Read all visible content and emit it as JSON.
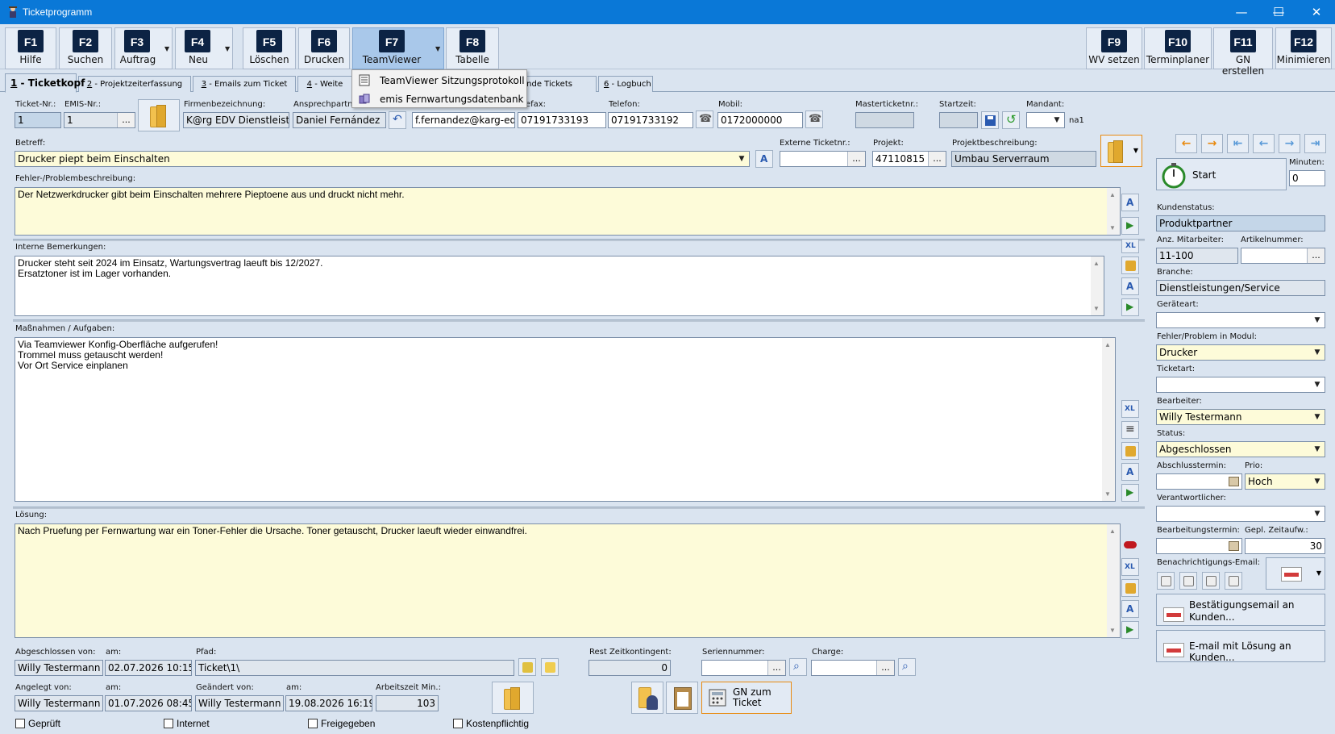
{
  "window": {
    "title": "Ticketprogramm",
    "minimize": "—",
    "maximize": "☐",
    "close": "✕"
  },
  "toolbar": {
    "buttons": [
      {
        "key": "F1",
        "label": "Hilfe"
      },
      {
        "key": "F2",
        "label": "Suchen"
      },
      {
        "key": "F3",
        "label": "Auftrag"
      },
      {
        "key": "F4",
        "label": "Neu"
      },
      {
        "key": "F5",
        "label": "Löschen"
      },
      {
        "key": "F6",
        "label": "Drucken"
      },
      {
        "key": "F7",
        "label": "TeamViewer"
      },
      {
        "key": "F8",
        "label": "Tabelle"
      },
      {
        "key": "F9",
        "label": "WV setzen"
      },
      {
        "key": "F10",
        "label": "Terminplaner"
      },
      {
        "key": "F11",
        "label": "GN erstellen"
      },
      {
        "key": "F12",
        "label": "Minimieren"
      }
    ]
  },
  "dropdown_menu": {
    "items": [
      "TeamViewer Sitzungsprotokoll",
      "emis Fernwartungsdatenbank"
    ]
  },
  "tabs": [
    {
      "num": "1",
      "label": " - Ticketkopf"
    },
    {
      "num": "2",
      "label": " - Projektzeiterfassung"
    },
    {
      "num": "3",
      "label": " - Emails zum Ticket"
    },
    {
      "num": "4",
      "label": " - Weite"
    },
    {
      "num": "",
      "label": "ende Tickets"
    },
    {
      "num": "6",
      "label": " - Logbuch"
    }
  ],
  "header_fields": {
    "ticket_nr": {
      "label": "Ticket-Nr.:",
      "value": "1"
    },
    "emis_nr": {
      "label": "EMIS-Nr.:",
      "value": "1"
    },
    "firma": {
      "label": "Firmenbezeichnung:",
      "value": "K@rg EDV Dienstleistungen"
    },
    "ansprechpartner": {
      "label": "Ansprechpartner",
      "value": "Daniel Fernández"
    },
    "email": {
      "value": "f.fernandez@karg-edv.de"
    },
    "telefax": {
      "label": "elefax:",
      "value": "07191733193"
    },
    "telefon": {
      "label": "Telefon:",
      "value": "07191733192"
    },
    "mobil": {
      "label": "Mobil:",
      "value": "0172000000"
    },
    "masterticket": {
      "label": "Masterticketnr.:",
      "value": ""
    },
    "startzeit": {
      "label": "Startzeit:",
      "value": ""
    },
    "mandant": {
      "label": "Mandant:",
      "value": "",
      "suffix": "na1"
    }
  },
  "betreff": {
    "label": "Betreff:",
    "value": "Drucker piept beim Einschalten"
  },
  "externe_ticketnr": {
    "label": "Externe Ticketnr.:",
    "value": ""
  },
  "projekt": {
    "label": "Projekt:",
    "value": "47110815"
  },
  "projektbeschreibung": {
    "label": "Projektbeschreibung:",
    "value": "Umbau Serverraum"
  },
  "fehler": {
    "label": "Fehler-/Problembeschreibung:",
    "lines": [
      "Der Netzwerkdrucker gibt beim Einschalten mehrere Pieptoene aus und druckt nicht mehr."
    ]
  },
  "interne": {
    "label": "Interne Bemerkungen:",
    "lines": [
      "Drucker steht seit 2024 im Einsatz, Wartungsvertrag laeuft bis 12/2027.",
      "Ersatztoner ist im Lager vorhanden."
    ]
  },
  "massnahmen": {
    "label": "Maßnahmen / Aufgaben:",
    "lines": [
      "Via Teamviewer Konfig-Oberfläche aufgerufen!",
      "Trommel muss getauscht werden!",
      "Vor Ort Service einplanen"
    ]
  },
  "loesung": {
    "label": "Lösung:",
    "lines": [
      "Nach Pruefung per Fernwartung war ein Toner-Fehler die Ursache. Toner getauscht, Drucker laeuft wieder einwandfrei."
    ]
  },
  "bottom": {
    "abgeschlossen_von": {
      "label": "Abgeschlossen von:",
      "value": "Willy Testermann"
    },
    "abgeschlossen_am": {
      "label": "am:",
      "value": "02.07.2026 10:15:00"
    },
    "pfad": {
      "label": "Pfad:",
      "value": "Ticket\\1\\"
    },
    "rest_zeit": {
      "label": "Rest Zeitkontingent:",
      "value": "0"
    },
    "seriennummer": {
      "label": "Seriennummer:",
      "value": ""
    },
    "charge": {
      "label": "Charge:",
      "value": ""
    },
    "angelegt_von": {
      "label": "Angelegt von:",
      "value": "Willy Testermann"
    },
    "angelegt_am": {
      "label": "am:",
      "value": "01.07.2026 08:45:00"
    },
    "geaendert_von": {
      "label": "Geändert von:",
      "value": "Willy Testermann"
    },
    "geaendert_am": {
      "label": "am:",
      "value": "19.08.2026 16:19:02"
    },
    "arbeitszeit": {
      "label": "Arbeitszeit Min.:",
      "value": "103"
    },
    "gn_button": "GN zum\nTicket",
    "checkboxes": [
      "Geprüft",
      "Internet",
      "Freigegeben",
      "Kostenpflichtig"
    ]
  },
  "right_panel": {
    "start_label": "Start",
    "minuten": {
      "label": "Minuten:",
      "value": "0"
    },
    "kundenstatus": {
      "label": "Kundenstatus:",
      "value": "Produktpartner"
    },
    "anz_mitarbeiter": {
      "label": "Anz. Mitarbeiter:",
      "value": "11-100"
    },
    "artikelnummer": {
      "label": "Artikelnummer:",
      "value": ""
    },
    "branche": {
      "label": "Branche:",
      "value": "Dienstleistungen/Service"
    },
    "geraeteart": {
      "label": "Geräteart:",
      "value": ""
    },
    "fehler_modul": {
      "label": "Fehler/Problem in Modul:",
      "value": "Drucker"
    },
    "ticketart": {
      "label": "Ticketart:",
      "value": ""
    },
    "bearbeiter": {
      "label": "Bearbeiter:",
      "value": "Willy Testermann"
    },
    "status": {
      "label": "Status:",
      "value": "Abgeschlossen"
    },
    "abschlusstermin": {
      "label": "Abschlusstermin:",
      "value": ""
    },
    "prio": {
      "label": "Prio:",
      "value": "Hoch"
    },
    "verantwortlicher": {
      "label": "Verantwortlicher:",
      "value": ""
    },
    "bearbeitungstermin": {
      "label": "Bearbeitungstermin:",
      "value": ""
    },
    "gepl_zeitaufw": {
      "label": "Gepl. Zeitaufw.:",
      "value": "30"
    },
    "benachrichtigung": {
      "label": "Benachrichtigungs-Email:"
    },
    "bestaetigung_btn": "Bestätigungsemail an Kunden...",
    "email_loesung_btn": "E-mail mit Lösung an Kunden..."
  },
  "colors": {
    "titlebar": "#0a78d7",
    "background": "#dae4f0",
    "yellow_field": "#fdfbd9",
    "fkey": "#0c2344"
  }
}
